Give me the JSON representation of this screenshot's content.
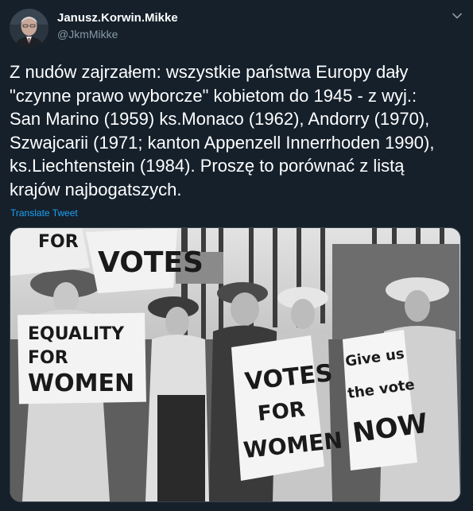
{
  "tweet": {
    "author": {
      "display_name": "Janusz.Korwin.Mikke",
      "handle": "@JkmMikke"
    },
    "text_lines": [
      "Z nudów zajrzałem: wszystkie państwa Europy dały",
      "\"czynne prawo wyborcze\" kobietom do 1945 - z wyj.:",
      "San Marino (1959) ks.Monaco (1962), Andorry (1970),",
      "Szwajcarii (1971; kanton Appenzell Innerrhoden 1990),",
      "ks.Liechtenstein (1984). Proszę to porównać z listą",
      "krajów najbogatszych."
    ],
    "translate_label": "Translate Tweet",
    "menu_icon": "chevron-down-icon"
  },
  "photo": {
    "signs": {
      "equality": [
        "EQUALITY",
        "FOR",
        "WOMEN"
      ],
      "votes_top": [
        "FOR",
        "VOTES"
      ],
      "votes_center": [
        "VOTES",
        "FOR",
        "WOMEN"
      ],
      "give_us": [
        "Give us",
        "the vote",
        "NOW"
      ]
    }
  },
  "colors": {
    "background": "#15202b",
    "text": "#ffffff",
    "secondary_text": "#8899a6",
    "link": "#1da1f2",
    "border": "#38444d"
  }
}
